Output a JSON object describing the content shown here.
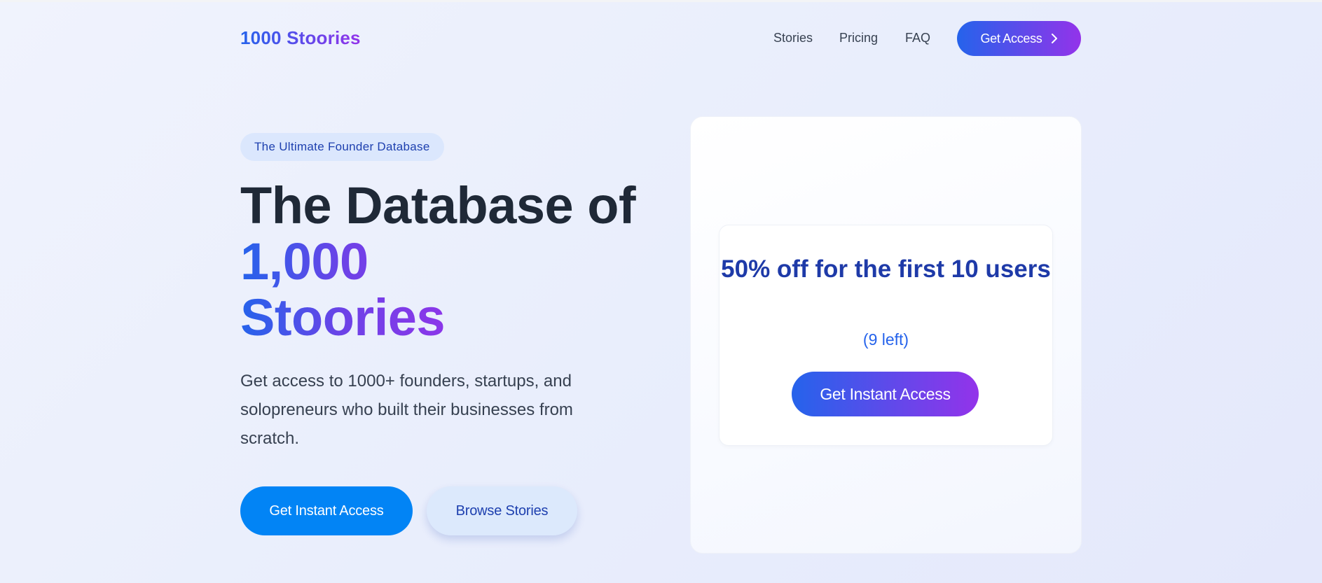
{
  "header": {
    "logo": "1000 Stoories",
    "nav": [
      "Stories",
      "Pricing",
      "FAQ"
    ],
    "cta_label": "Get Access",
    "cta_icon": "chevron-right-icon"
  },
  "hero": {
    "badge": "The Ultimate Founder Database",
    "title_line1": "The Database of",
    "title_line2": "1,000",
    "title_line3": "Stoories",
    "description": "Get access to 1000+ founders, startups, and solopreneurs who built their businesses from scratch.",
    "primary_button": "Get Instant Access",
    "secondary_button": "Browse Stories"
  },
  "offer": {
    "title": "50% off for the first 10 users",
    "remaining": "(9 left)",
    "button": "Get Instant Access"
  },
  "colors": {
    "gradient_start": "#2563eb",
    "gradient_end": "#9333ea",
    "primary_button": "#0284f5",
    "secondary_button": "#dce9fc",
    "heading": "#1f2937"
  }
}
